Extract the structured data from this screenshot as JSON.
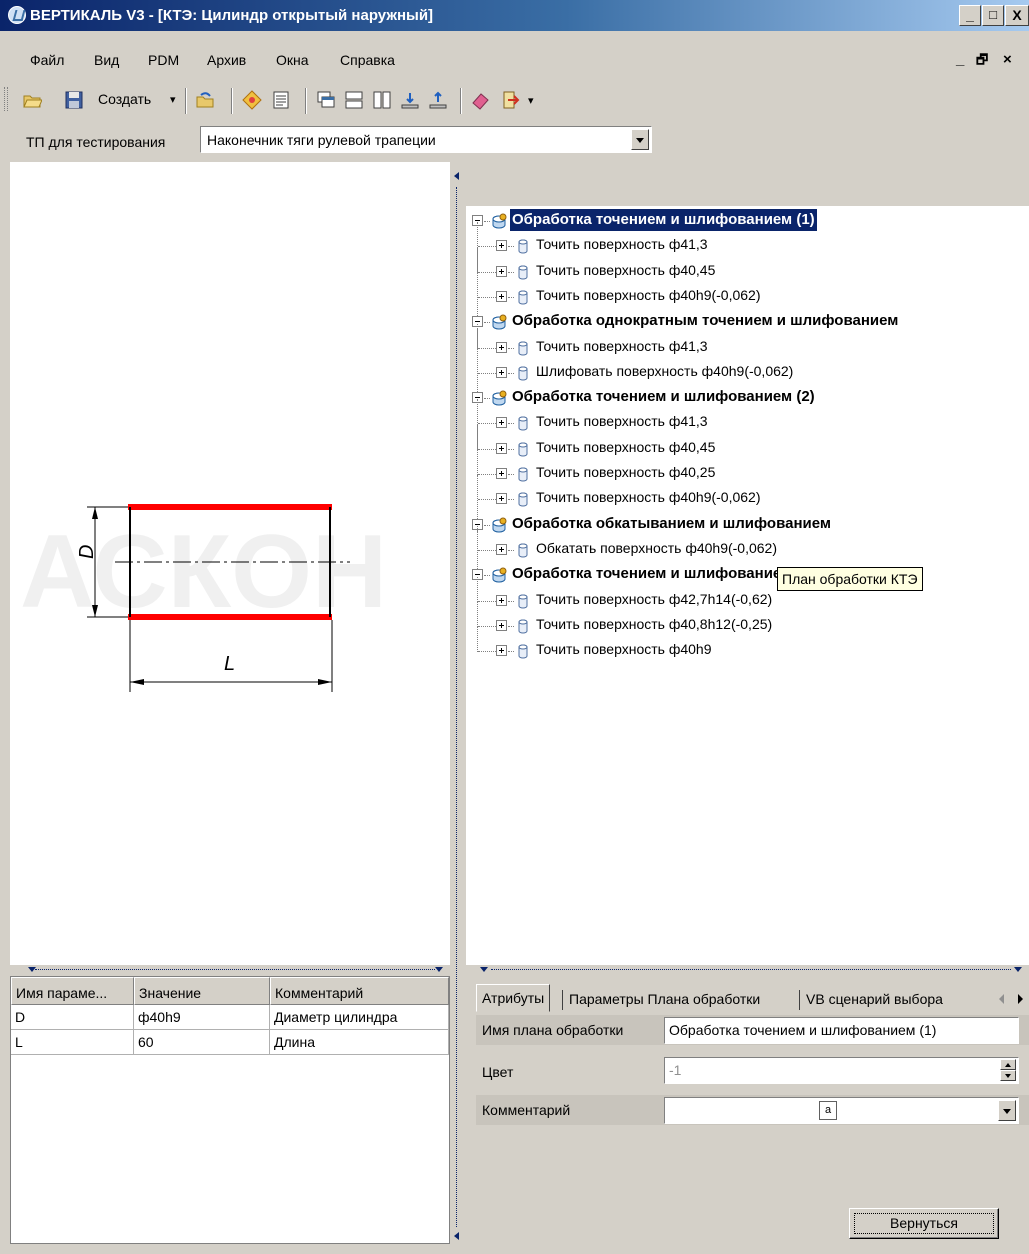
{
  "window": {
    "title": "ВЕРТИКАЛЬ V3 - [КТЭ: Цилиндр открытый наружный]",
    "minimize": "_",
    "maximize": "□",
    "close": "X"
  },
  "menu": {
    "items": [
      "Файл",
      "Вид",
      "PDM",
      "Архив",
      "Окна",
      "Справка"
    ],
    "mdi_min": "_",
    "mdi_restore": "🗗",
    "mdi_close": "×"
  },
  "toolbar": {
    "create_label": "Создать",
    "create_arrow": "▾",
    "overflow": "▾"
  },
  "tp": {
    "label": "ТП для тестирования",
    "selected": "Наконечник тяги рулевой трапеции"
  },
  "drawing": {
    "watermark": "АСКОН",
    "dim_d": "D",
    "dim_l": "L"
  },
  "param_table": {
    "columns": [
      "Имя параме...",
      "Значение",
      "Комментарий"
    ],
    "rows": [
      [
        "D",
        "ф40h9",
        "Диаметр цилиндра"
      ],
      [
        "L",
        "60",
        "Длина"
      ]
    ]
  },
  "tree": {
    "nodes": [
      {
        "label": "Обработка точением и шлифованием (1)",
        "root": true,
        "selected": true
      },
      {
        "label": "Точить поверхность ф41,3",
        "root": false
      },
      {
        "label": "Точить поверхность ф40,45",
        "root": false
      },
      {
        "label": "Точить поверхность ф40h9(-0,062)",
        "root": false
      },
      {
        "label": "Обработка однократным точением и шлифованием",
        "root": true
      },
      {
        "label": "Точить поверхность ф41,3",
        "root": false
      },
      {
        "label": "Шлифовать поверхность ф40h9(-0,062)",
        "root": false
      },
      {
        "label": "Обработка точением и шлифованием (2)",
        "root": true
      },
      {
        "label": "Точить поверхность ф41,3",
        "root": false
      },
      {
        "label": "Точить поверхность ф40,45",
        "root": false
      },
      {
        "label": "Точить поверхность ф40,25",
        "root": false
      },
      {
        "label": "Точить поверхность ф40h9(-0,062)",
        "root": false
      },
      {
        "label": "Обработка обкатыванием и шлифованием",
        "root": true
      },
      {
        "label": "Обкатать поверхность ф40h9(-0,062)",
        "root": false
      },
      {
        "label": "Обработка точением и шлифованием (3)",
        "root": true
      },
      {
        "label": "Точить поверхность ф42,7h14(-0,62)",
        "root": false
      },
      {
        "label": "Точить поверхность ф40,8h12(-0,25)",
        "root": false
      },
      {
        "label": "Точить поверхность ф40h9",
        "root": false
      }
    ],
    "tooltip": "План обработки КТЭ"
  },
  "tabs": {
    "items": [
      "Атрибуты",
      "Параметры Плана обработки",
      "VB сценарий выбора"
    ],
    "active": 0
  },
  "props": {
    "plan_name_label": "Имя плана обработки",
    "plan_name_value": "Обработка точением и шлифованием (1)",
    "color_label": "Цвет",
    "color_value": "-1",
    "comment_label": "Комментарий",
    "comment_icon": "a"
  },
  "buttons": {
    "return": "Вернуться"
  },
  "colors": {
    "title_bar": "#0a246a",
    "selection": "#0a246a",
    "drawing_red": "#ff0000",
    "tooltip_bg": "#ffffe1"
  }
}
